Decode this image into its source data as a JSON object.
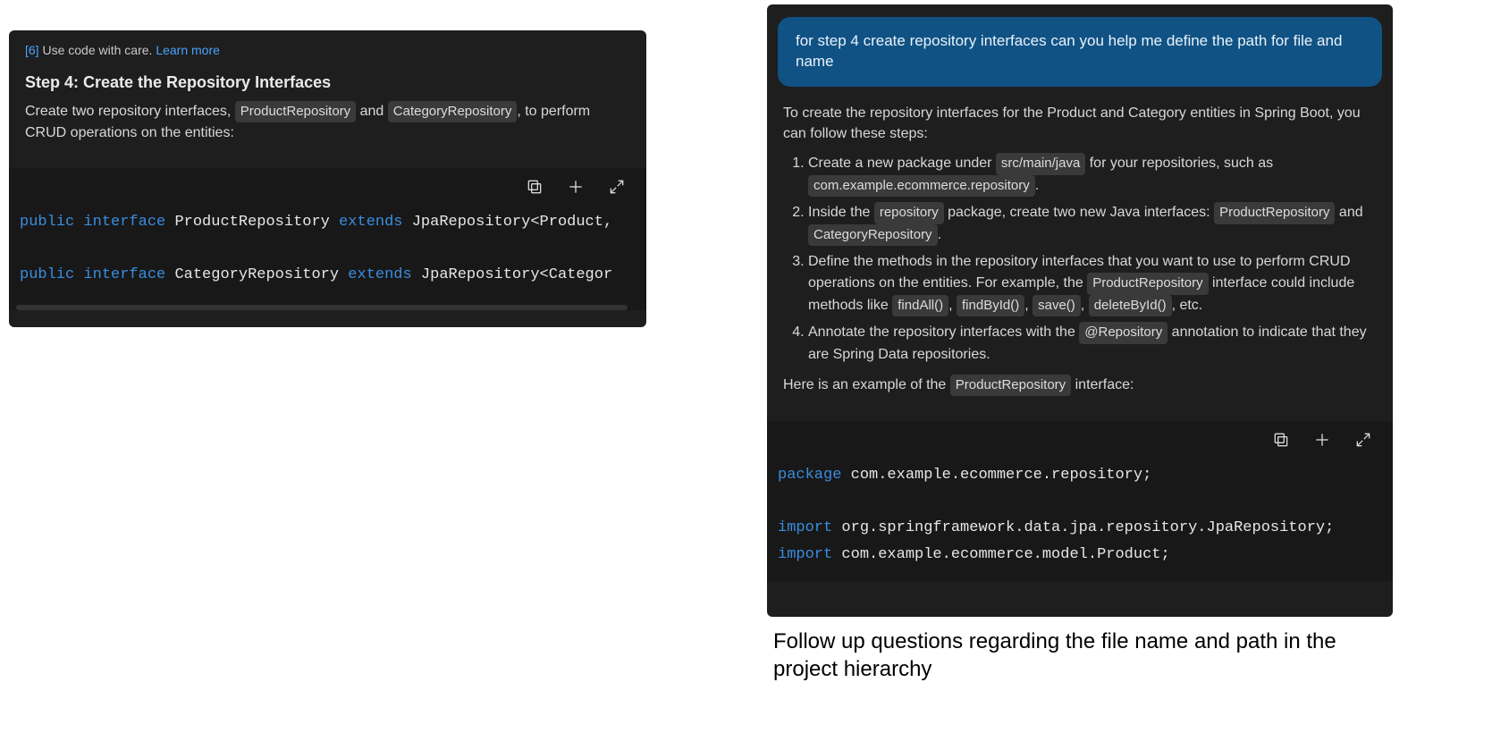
{
  "left": {
    "cite_bracket": "[6]",
    "cite_text": "Use code with care.",
    "cite_link": "Learn more",
    "heading": "Step 4: Create the Repository Interfaces",
    "para_before": "Create two repository interfaces, ",
    "chip1": "ProductRepository",
    "para_mid": " and ",
    "chip2": "CategoryRepository",
    "para_after": ", to perform CRUD operations on the entities:",
    "code": {
      "l1_kw1": "public",
      "l1_kw2": "interface",
      "l1_txt1": " ProductRepository ",
      "l1_kw3": "extends",
      "l1_txt2": " JpaRepository<Product,",
      "l2_kw1": "public",
      "l2_kw2": "interface",
      "l2_txt1": " CategoryRepository ",
      "l2_kw3": "extends",
      "l2_txt2": " JpaRepository<Categor"
    }
  },
  "right": {
    "user_msg": "for step 4 create repository interfaces can you help me define the path for file and name",
    "intro": "To create the repository interfaces for the Product and Category entities in Spring Boot, you can follow these steps:",
    "steps": [
      {
        "pre": "Create a new package under ",
        "c1": "src/main/java",
        "mid": " for your repositories, such as ",
        "c2": "com.example.ecommerce.repository",
        "post": "."
      },
      {
        "pre": "Inside the ",
        "c1": "repository",
        "mid": " package, create two new Java interfaces: ",
        "c2": "ProductRepository",
        "mid2": " and ",
        "c3": "CategoryRepository",
        "post": "."
      },
      {
        "pre": "Define the methods in the repository interfaces that you want to use to perform CRUD operations on the entities. For example, the ",
        "c1": "ProductRepository",
        "mid": " interface could include methods like ",
        "c2": "findAll()",
        "mid2": ", ",
        "c3": "findById()",
        "mid3": ", ",
        "c4": "save()",
        "mid4": ", ",
        "c5": "deleteById()",
        "post": ", etc."
      },
      {
        "pre": "Annotate the repository interfaces with the ",
        "c1": "@Repository",
        "post": " annotation to indicate that they are Spring Data repositories."
      }
    ],
    "outro_pre": "Here is an example of the ",
    "outro_chip": "ProductRepository",
    "outro_post": " interface:",
    "code": {
      "l1_kw": "package",
      "l1_txt": " com.example.ecommerce.repository;",
      "l2_kw": "import",
      "l2_txt": " org.springframework.data.jpa.repository.JpaRepository;",
      "l3_kw": "import",
      "l3_txt": " com.example.ecommerce.model.Product;"
    }
  },
  "caption": "Follow up questions regarding the file name and path in the project hierarchy"
}
